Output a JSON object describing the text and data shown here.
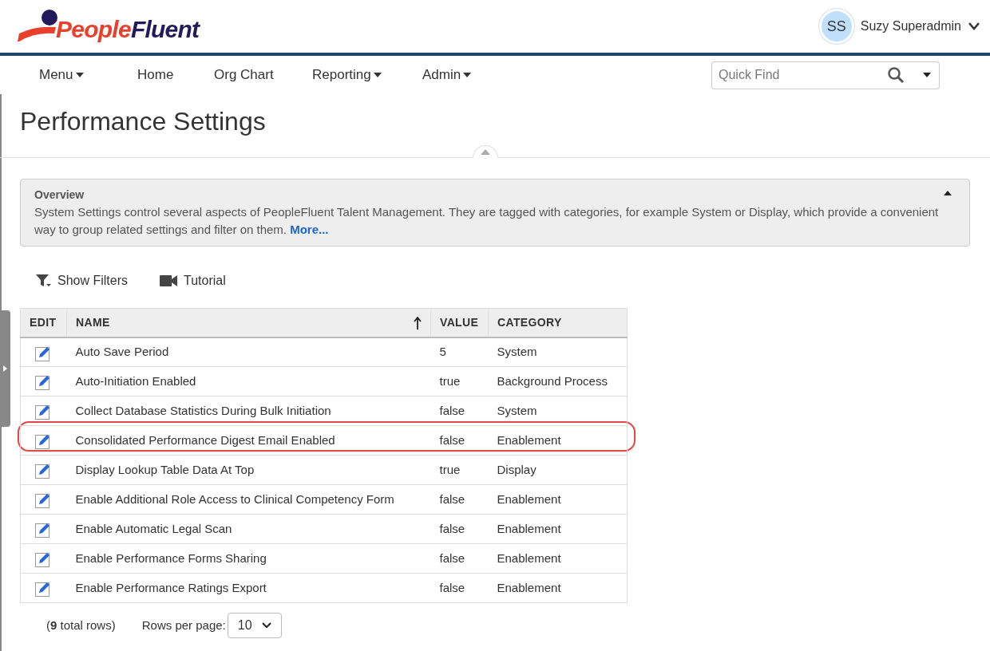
{
  "logo": {
    "part_1": "People",
    "part_2": "Fluent"
  },
  "user": {
    "initials": "SS",
    "name": "Suzy Superadmin"
  },
  "nav": [
    {
      "label": "Menu",
      "dropdown": true
    },
    {
      "label": "Home",
      "dropdown": false
    },
    {
      "label": "Org Chart",
      "dropdown": false
    },
    {
      "label": "Reporting",
      "dropdown": true
    },
    {
      "label": "Admin",
      "dropdown": true
    }
  ],
  "quick_find": {
    "placeholder": "Quick Find"
  },
  "page_title": "Performance Settings",
  "overview": {
    "title": "Overview",
    "text": "System Settings control several aspects of PeopleFluent Talent Management. They are tagged with categories, for example System or Display, which provide a convenient way to group related settings and filter on them.",
    "link": "More...",
    "expanded": true
  },
  "toolbar": [
    {
      "kind": "filter",
      "label": "Show Filters"
    },
    {
      "kind": "video",
      "label": "Tutorial"
    }
  ],
  "table": {
    "columns": [
      {
        "label": "EDIT",
        "sorted": false
      },
      {
        "label": "NAME",
        "sorted": true
      },
      {
        "label": "VALUE",
        "sorted": false
      },
      {
        "label": "CATEGORY",
        "sorted": false
      }
    ],
    "rows": [
      {
        "name": "Auto Save Period",
        "value": "5",
        "category": "System",
        "highlighted": false
      },
      {
        "name": "Auto-Initiation Enabled",
        "value": "true",
        "category": "Background Process",
        "highlighted": false
      },
      {
        "name": "Collect Database Statistics During Bulk Initiation",
        "value": "false",
        "category": "System",
        "highlighted": false
      },
      {
        "name": "Consolidated Performance Digest Email Enabled",
        "value": "false",
        "category": "Enablement",
        "highlighted": true
      },
      {
        "name": "Display Lookup Table Data At Top",
        "value": "true",
        "category": "Display",
        "highlighted": false
      },
      {
        "name": "Enable Additional Role Access to Clinical Competency Form",
        "value": "false",
        "category": "Enablement",
        "highlighted": false
      },
      {
        "name": "Enable Automatic Legal Scan",
        "value": "false",
        "category": "Enablement",
        "highlighted": false
      },
      {
        "name": "Enable Performance Forms Sharing",
        "value": "false",
        "category": "Enablement",
        "highlighted": false
      },
      {
        "name": "Enable Performance Ratings Export",
        "value": "false",
        "category": "Enablement",
        "highlighted": false
      }
    ]
  },
  "footer": {
    "total": "(**9** total rows)",
    "rows_per_page_label": "Rows per page:",
    "rows_per_page": "10"
  }
}
